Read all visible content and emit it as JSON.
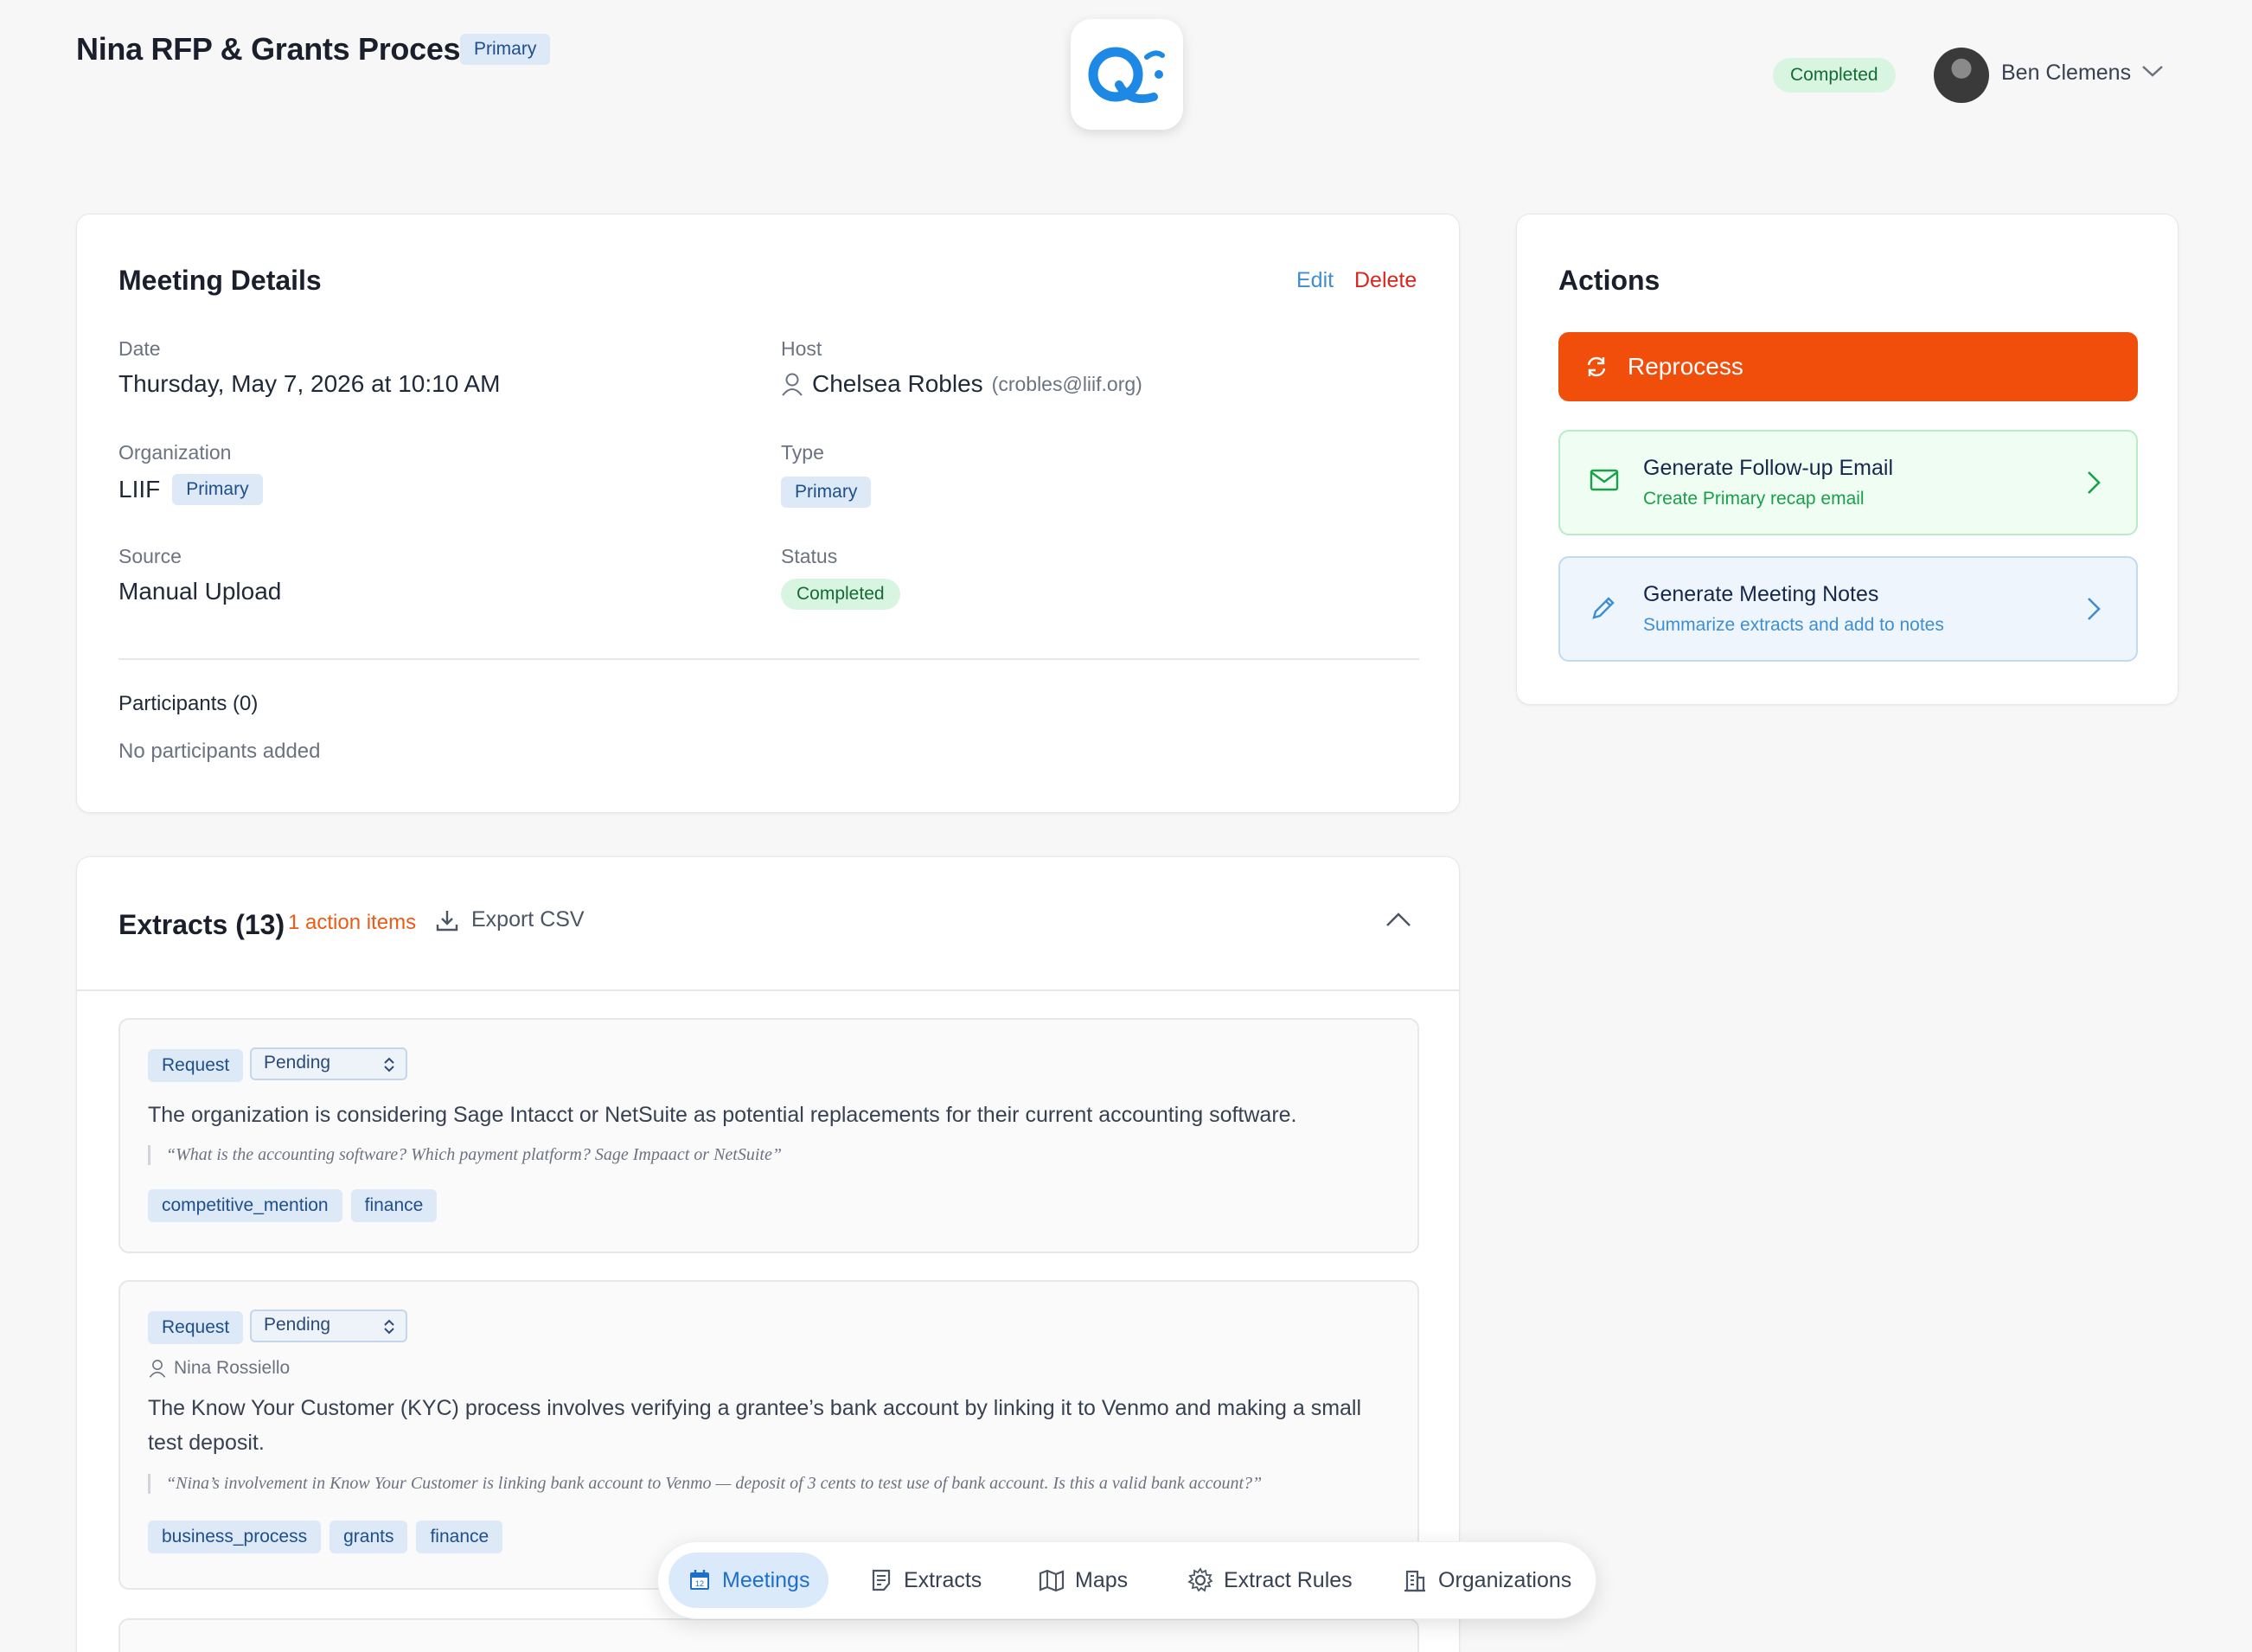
{
  "header": {
    "title": "Nina RFP & Grants Process",
    "badge": "Primary",
    "status": "Completed",
    "user": {
      "name": "Ben Clemens"
    }
  },
  "details": {
    "title": "Meeting Details",
    "edit": "Edit",
    "delete": "Delete",
    "date_label": "Date",
    "date_value": "Thursday, May 7, 2026 at 10:10 AM",
    "host_label": "Host",
    "host_name": "Chelsea Robles",
    "host_email": "(crobles@liif.org)",
    "org_label": "Organization",
    "org_value": "LIIF",
    "org_badge": "Primary",
    "type_label": "Type",
    "type_value": "Primary",
    "source_label": "Source",
    "source_value": "Manual Upload",
    "status_label": "Status",
    "status_value": "Completed",
    "participants_title": "Participants (0)",
    "participants_empty": "No participants added"
  },
  "actions": {
    "title": "Actions",
    "reprocess": "Reprocess",
    "followup_title": "Generate Follow-up Email",
    "followup_sub": "Create Primary recap email",
    "notes_title": "Generate Meeting Notes",
    "notes_sub": "Summarize extracts and add to notes",
    "colors": {
      "reprocess": "#f24e0b",
      "green": "#18a04a",
      "blue": "#3f8ed1"
    }
  },
  "extracts": {
    "title": "Extracts (13)",
    "action_items": "1 action items",
    "export": "Export CSV",
    "items": [
      {
        "type": "Request",
        "status": "Pending",
        "text": "The organization is considering Sage Intacct or NetSuite as potential replacements for their current accounting software.",
        "quote": "“What is the accounting software? Which payment platform? Sage Impaact or NetSuite”",
        "tags": [
          "competitive_mention",
          "finance"
        ]
      },
      {
        "type": "Request",
        "status": "Pending",
        "speaker": "Nina Rossiello",
        "text": "The Know Your Customer (KYC) process involves verifying a grantee’s bank account by linking it to Venmo and making a small test deposit.",
        "quote": "“Nina’s involvement in Know Your Customer is linking bank account to Venmo — deposit of 3 cents to test use of bank account. Is this a valid bank account?”",
        "tags": [
          "business_process",
          "grants",
          "finance"
        ]
      }
    ]
  },
  "nav": {
    "items": [
      {
        "label": "Meetings",
        "icon": "calendar-icon",
        "active": true
      },
      {
        "label": "Extracts",
        "icon": "document-icon"
      },
      {
        "label": "Maps",
        "icon": "map-icon"
      },
      {
        "label": "Extract Rules",
        "icon": "gear-icon"
      },
      {
        "label": "Organizations",
        "icon": "building-icon"
      }
    ]
  }
}
